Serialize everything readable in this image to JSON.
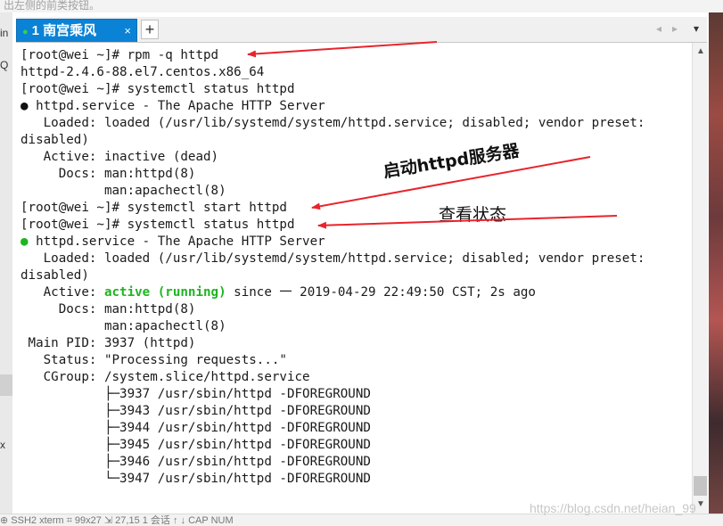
{
  "top_strip": {
    "text": "出左侧的前类按钮。"
  },
  "tab": {
    "label": "1 南宫乘风",
    "close": "×",
    "new": "+"
  },
  "nav": {
    "prev": "◂",
    "next": "▸",
    "menu": "▾"
  },
  "left_strip": {
    "label1": "in",
    "label2": "Q",
    "label3": "x"
  },
  "scroll": {
    "up": "▲",
    "down": "▼"
  },
  "terminal": {
    "lines": [
      "[root@wei ~]# rpm -q httpd",
      "httpd-2.4.6-88.el7.centos.x86_64",
      "[root@wei ~]# systemctl status httpd",
      {
        "dot": "●",
        "text": " httpd.service - The Apache HTTP Server"
      },
      "   Loaded: loaded (/usr/lib/systemd/system/httpd.service; disabled; vendor preset:",
      "disabled)",
      "   Active: inactive (dead)",
      "     Docs: man:httpd(8)",
      "           man:apachectl(8)",
      "[root@wei ~]# systemctl start httpd",
      "[root@wei ~]# systemctl status httpd",
      {
        "dot": "●",
        "text": " httpd.service - The Apache HTTP Server",
        "green_dot": true
      },
      "   Loaded: loaded (/usr/lib/systemd/system/httpd.service; disabled; vendor preset:",
      "disabled)",
      {
        "pre": "   Active: ",
        "green": "active (running)",
        "post": " since 一 2019-04-29 22:49:50 CST; 2s ago"
      },
      "     Docs: man:httpd(8)",
      "           man:apachectl(8)",
      " Main PID: 3937 (httpd)",
      "   Status: \"Processing requests...\"",
      "   CGroup: /system.slice/httpd.service",
      "           ├─3937 /usr/sbin/httpd -DFOREGROUND",
      "           ├─3943 /usr/sbin/httpd -DFOREGROUND",
      "           ├─3944 /usr/sbin/httpd -DFOREGROUND",
      "           ├─3945 /usr/sbin/httpd -DFOREGROUND",
      "           ├─3946 /usr/sbin/httpd -DFOREGROUND",
      "           └─3947 /usr/sbin/httpd -DFOREGROUND"
    ]
  },
  "annotations": {
    "start_label_prefix": "启动",
    "start_label_bold": "httpd",
    "start_label_suffix": "服务器",
    "status_label": "查看状态",
    "arrow_color": "#e8242c"
  },
  "watermark": "https://blog.csdn.net/heian_99",
  "statusbar": {
    "text": "  ⊕ SSH2    xterm    ⌗ 99x27    ⇲ 27,15    1 会话    ↑ ↓    CAP  NUM"
  },
  "colors": {
    "tab_active": "#0a82d6",
    "green_status": "#1fb51f"
  }
}
